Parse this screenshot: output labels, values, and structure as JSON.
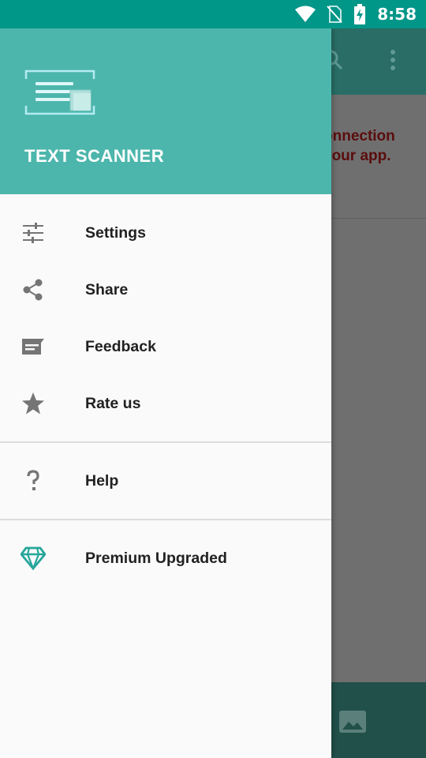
{
  "status_bar": {
    "time": "8:58",
    "icons": [
      "wifi-icon",
      "no-sim-icon",
      "battery-charging-icon"
    ]
  },
  "background_app": {
    "toolbar_icons": [
      "search-icon",
      "overflow-menu-icon"
    ],
    "error_text_line1": "onnection",
    "error_text_line2": "your app.",
    "bottom_icons": [
      "image-icon"
    ]
  },
  "drawer": {
    "app_title": "TEXT SCANNER",
    "menu": [
      {
        "label": "Settings",
        "icon": "sliders-icon"
      },
      {
        "label": "Share",
        "icon": "share-icon"
      },
      {
        "label": "Feedback",
        "icon": "feedback-icon"
      },
      {
        "label": "Rate us",
        "icon": "star-icon"
      }
    ],
    "help": {
      "label": "Help",
      "icon": "question-icon"
    },
    "premium": {
      "label": "Premium Upgraded",
      "icon": "diamond-icon"
    }
  },
  "colors": {
    "status_bar": "#009688",
    "drawer_header": "#4db6ac",
    "accent_teal": "#26a69a",
    "icon_gray": "#757575"
  }
}
